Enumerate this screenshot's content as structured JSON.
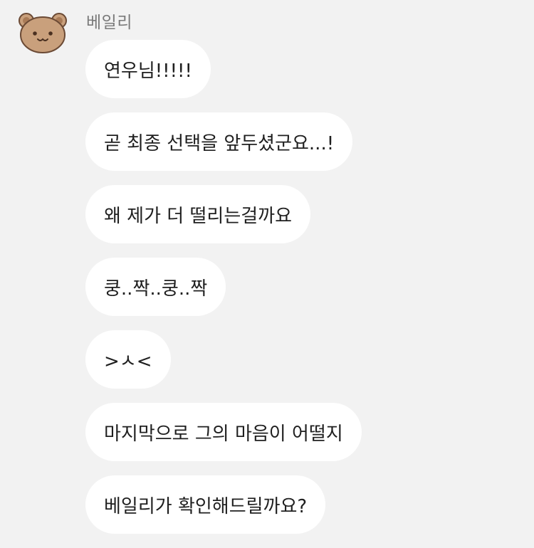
{
  "chat": {
    "sender_name": "베일리",
    "avatar_icon": "bear-face-icon",
    "avatar_colors": {
      "fur": "#c9a07c",
      "ear_inner": "#b98c66",
      "outline": "#6b4a35"
    },
    "bubble_color": "#ffffff",
    "background_color": "#f2f2f2",
    "messages": [
      {
        "text": "연우님!!!!!"
      },
      {
        "text": "곧 최종 선택을 앞두셨군요...!"
      },
      {
        "text": "왜 제가 더 떨리는걸까요"
      },
      {
        "text": "쿵..짝..쿵..짝"
      },
      {
        "text": ">ㅅ<"
      },
      {
        "text": "마지막으로 그의 마음이 어떨지"
      },
      {
        "text": "베일리가 확인해드릴까요?"
      }
    ]
  }
}
